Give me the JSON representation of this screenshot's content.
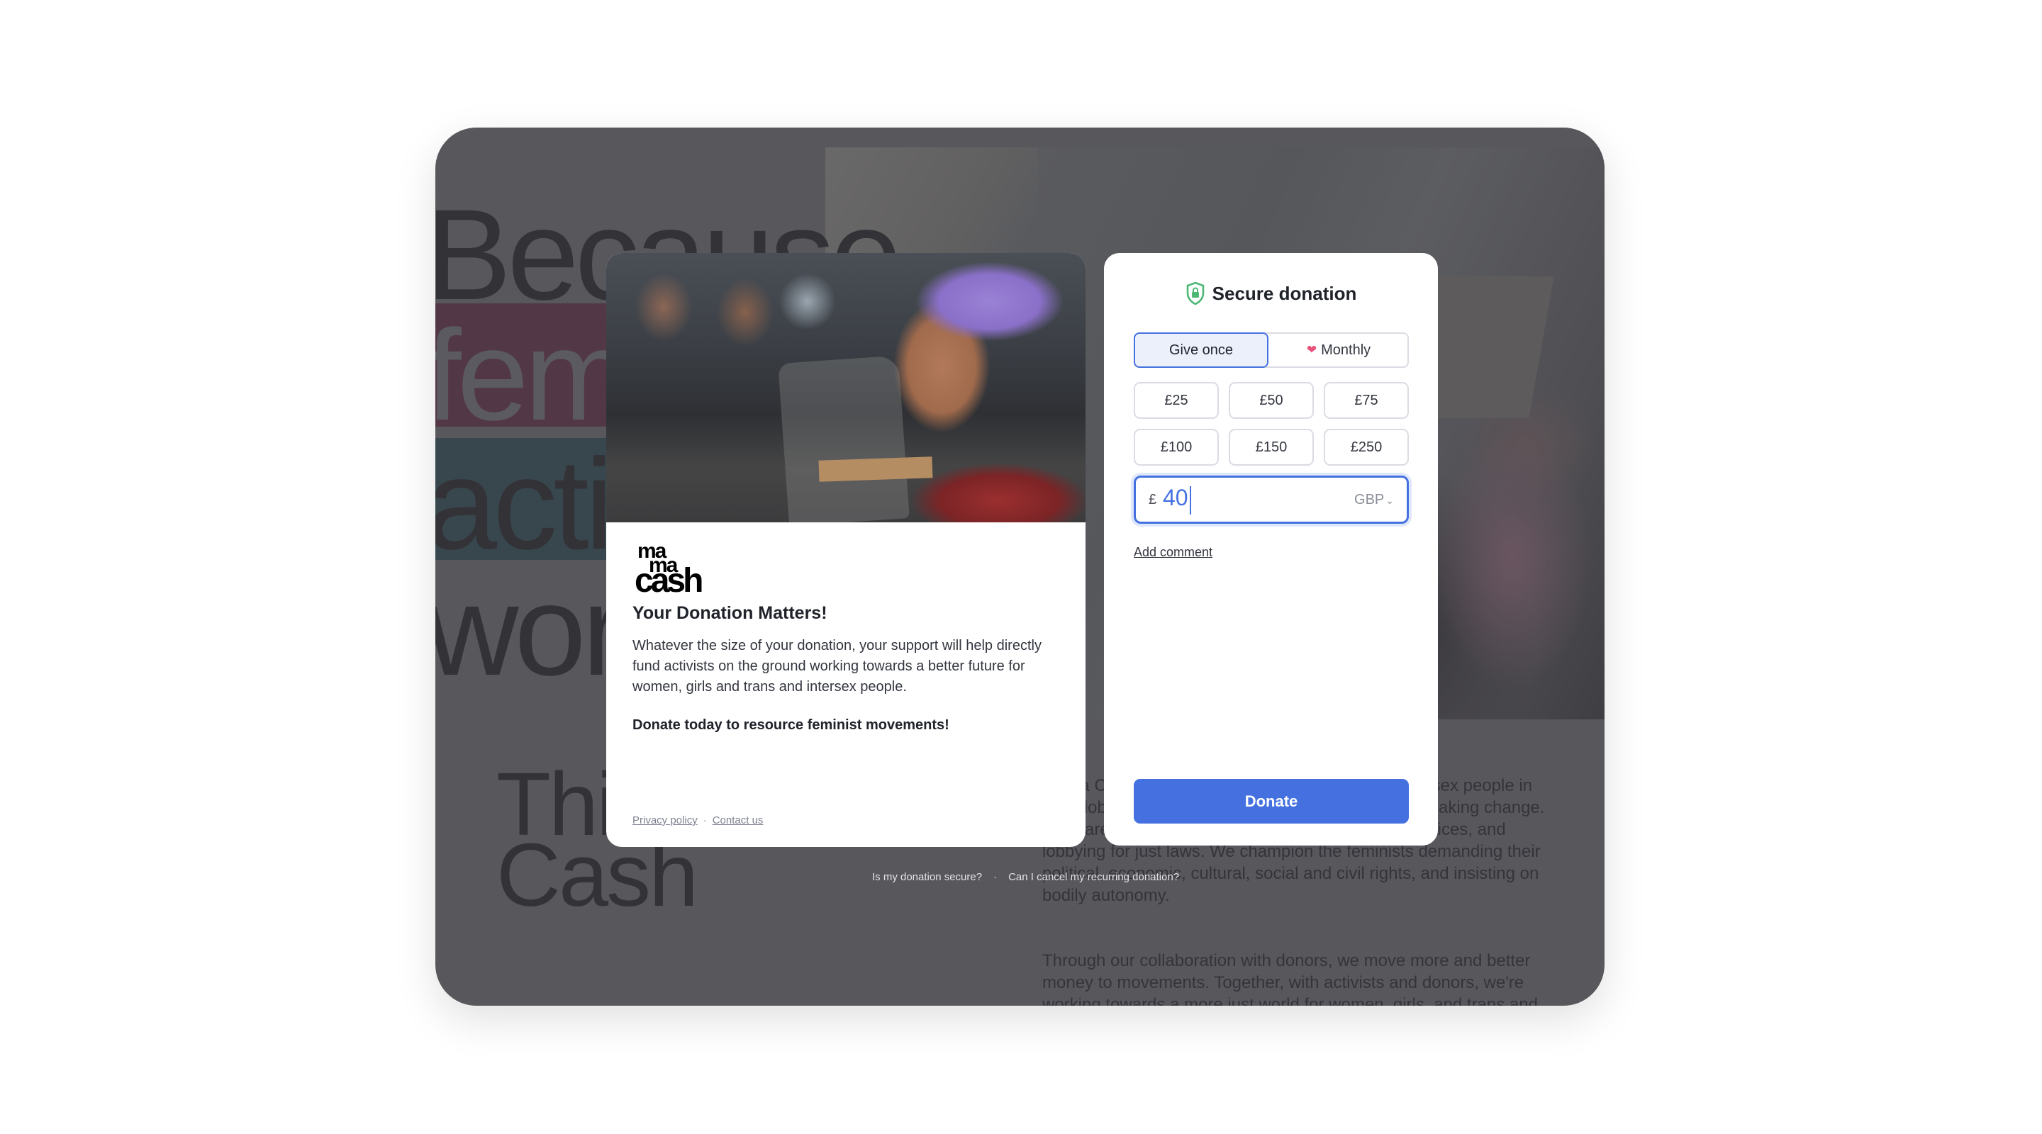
{
  "background_page": {
    "headline_words": [
      "Because",
      "femi",
      "activ",
      "work"
    ],
    "subheading": [
      "Thi",
      "Cash"
    ],
    "paragraph_1": "Mama Cash funds women, girls, and trans and intersex people in the Global South and North who are courageously making change. They are challenging harmful social norms and practices, and lobbying for just laws. We champion the feminists demanding their political, economic, cultural, social and civil rights, and insisting on bodily autonomy.",
    "paragraph_2": "Through our collaboration with donors, we move more and better money to movements. Together, with activists and donors, we're working towards a more just world for women, girls, and trans and",
    "highlight_colors": {
      "pink": "#523747",
      "teal": "#37474d"
    }
  },
  "info_card": {
    "logo": {
      "line1": "ma",
      "line2": "ma",
      "line3": "cash"
    },
    "title": "Your Donation Matters!",
    "body": "Whatever the size of your donation, your support will help directly fund activists on the ground working towards a better future for women, girls and trans and intersex people.",
    "cta": "Donate today to resource feminist movements!",
    "footer_links": [
      "Privacy policy",
      "Contact us"
    ],
    "footer_separator": "·"
  },
  "donation_form": {
    "header_icon": "shield-lock-icon",
    "header": "Secure donation",
    "frequency": {
      "options": [
        {
          "label": "Give once",
          "selected": true
        },
        {
          "label": "Monthly",
          "icon": "heart-icon",
          "selected": false
        }
      ]
    },
    "amounts": [
      "£25",
      "£50",
      "£75",
      "£100",
      "£150",
      "£250"
    ],
    "custom_amount": {
      "currency_symbol": "£",
      "value": "40",
      "currency": "GBP"
    },
    "add_comment": "Add comment",
    "donate_label": "Donate",
    "colors": {
      "accent": "#4571e0",
      "shield": "#4cb874",
      "heart": "#e8517a"
    }
  },
  "faq_links": [
    "Is my donation secure?",
    "Can I cancel my recurring donation?"
  ],
  "faq_separator": "·"
}
